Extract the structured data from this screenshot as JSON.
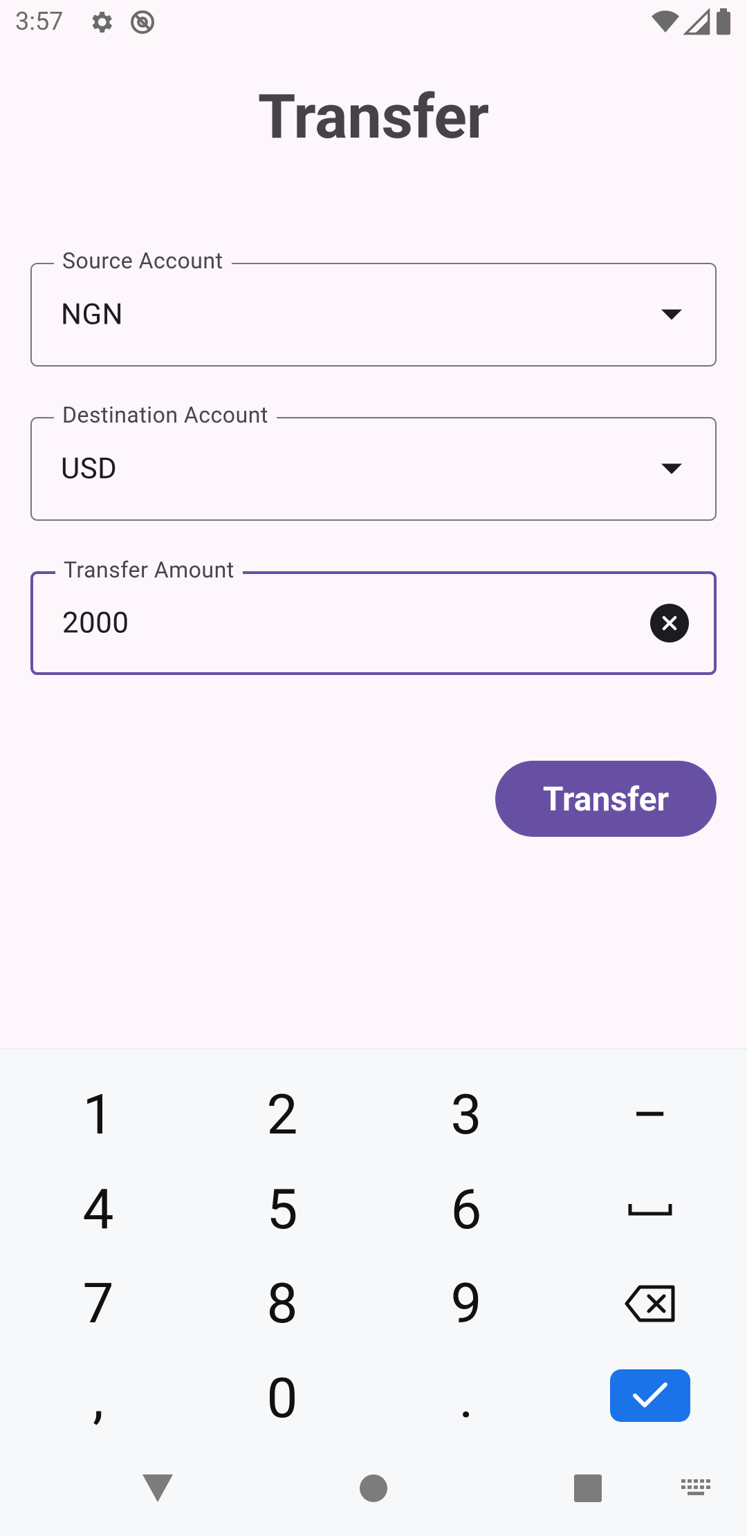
{
  "status": {
    "time": "3:57",
    "icons": [
      "gear-icon",
      "at-sign-icon",
      "wifi-icon",
      "signal-icon",
      "battery-icon"
    ]
  },
  "page": {
    "title": "Transfer"
  },
  "form": {
    "source": {
      "label": "Source Account",
      "value": "NGN"
    },
    "destination": {
      "label": "Destination Account",
      "value": "USD"
    },
    "amount": {
      "label": "Transfer Amount",
      "value": "2000"
    },
    "submit_label": "Transfer"
  },
  "keyboard": {
    "keys": [
      "1",
      "2",
      "3",
      "–",
      "4",
      "5",
      "6",
      "space",
      "7",
      "8",
      "9",
      "backspace",
      ",",
      "0",
      ".",
      "enter"
    ]
  },
  "colors": {
    "primary": "#6750a4",
    "background": "#fdf7fc",
    "enter_key": "#1a73e8",
    "title": "#464249"
  }
}
